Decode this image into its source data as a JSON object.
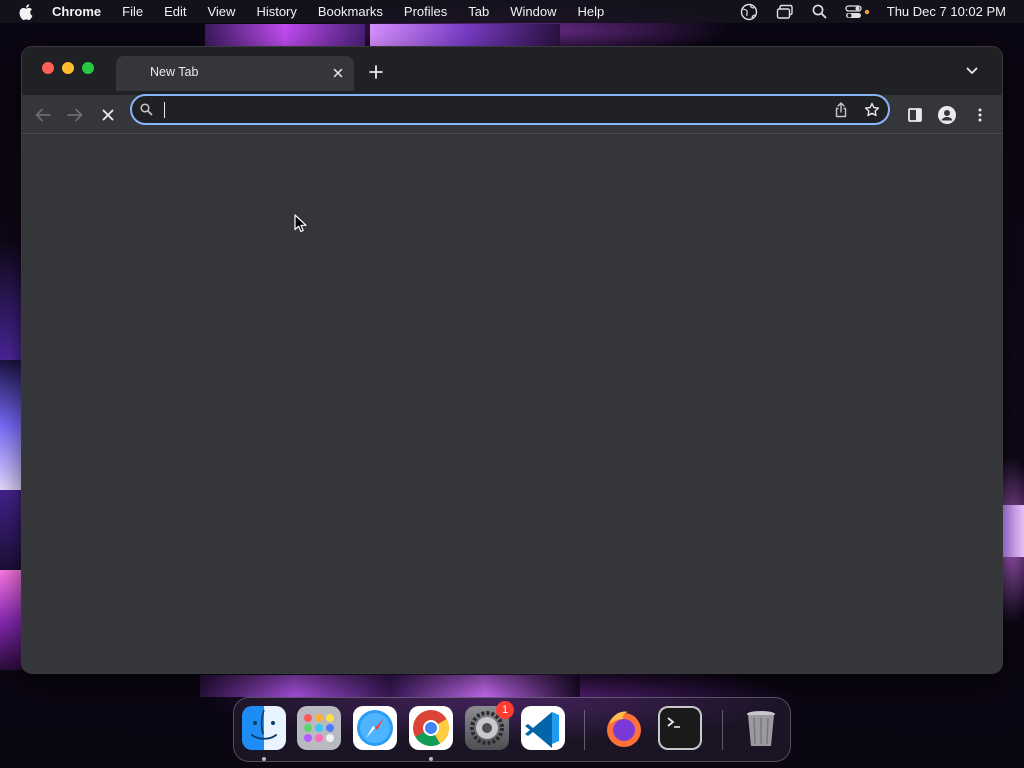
{
  "menubar": {
    "app_name": "Chrome",
    "items": [
      "File",
      "Edit",
      "View",
      "History",
      "Bookmarks",
      "Profiles",
      "Tab",
      "Window",
      "Help"
    ],
    "clock": "Thu Dec 7  10:02 PM",
    "status_icons": [
      "vpn-globe-icon",
      "screen-mirroring-icon",
      "spotlight-search-icon",
      "control-center-icon"
    ]
  },
  "browser": {
    "tab": {
      "title": "New Tab"
    },
    "omnibox": {
      "value": "",
      "placeholder": ""
    },
    "accent_color": "#8ab4f8"
  },
  "dock": {
    "apps": [
      {
        "name": "Finder",
        "icon": "finder-icon",
        "running": true
      },
      {
        "name": "Launchpad",
        "icon": "launchpad-icon",
        "running": false
      },
      {
        "name": "Safari",
        "icon": "safari-icon",
        "running": false
      },
      {
        "name": "Google Chrome",
        "icon": "chrome-icon",
        "running": true
      },
      {
        "name": "System Settings",
        "icon": "settings-icon",
        "running": false,
        "badge": "1"
      },
      {
        "name": "Visual Studio Code",
        "icon": "vscode-icon",
        "running": false
      },
      {
        "name": "Firefox",
        "icon": "firefox-icon",
        "running": false
      },
      {
        "name": "Terminal",
        "icon": "terminal-icon",
        "running": false
      },
      {
        "name": "Trash",
        "icon": "trash-icon",
        "running": false
      }
    ]
  }
}
